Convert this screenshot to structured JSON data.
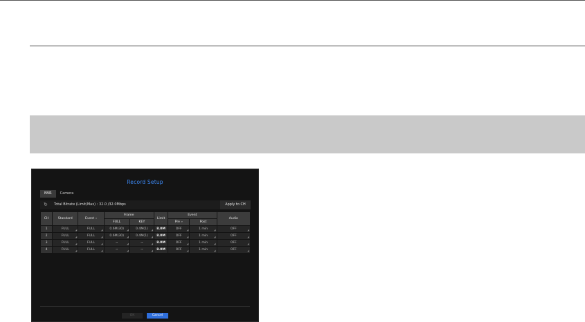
{
  "dialog": {
    "title": "Record Setup",
    "tabs": [
      "NVR",
      "Camera"
    ],
    "active_tab": "NVR",
    "bitrate_text": "Total Bitrate (Limit/Max) : 32.0 /32.0Mbps",
    "apply_button": "Apply to CH",
    "ok_button": "OK",
    "cancel_button": "Cancel"
  },
  "table": {
    "headers": {
      "ch": "CH",
      "standard": "Standard",
      "event": "Event",
      "frame": "Frame",
      "frame_full": "FULL",
      "frame_key": "KEY",
      "limit": "Limit",
      "event_group": "Event",
      "pre": "Pre",
      "post": "Post",
      "audio": "Audio"
    },
    "rows": [
      {
        "ch": "1",
        "standard": "FULL",
        "event": "FULL",
        "full": "0.6M(30)",
        "key": "0.4M(1)",
        "limit": "8.0M",
        "pre": "OFF",
        "post": "1 min",
        "audio": "OFF"
      },
      {
        "ch": "2",
        "standard": "FULL",
        "event": "FULL",
        "full": "0.6M(30)",
        "key": "0.4M(1)",
        "limit": "8.0M",
        "pre": "OFF",
        "post": "1 min",
        "audio": "OFF"
      },
      {
        "ch": "3",
        "standard": "FULL",
        "event": "FULL",
        "full": "~",
        "key": "~",
        "limit": "8.0M",
        "pre": "OFF",
        "post": "1 min",
        "audio": "OFF"
      },
      {
        "ch": "4",
        "standard": "FULL",
        "event": "FULL",
        "full": "~",
        "key": "~",
        "limit": "8.0M",
        "pre": "OFF",
        "post": "1 min",
        "audio": "OFF"
      }
    ]
  },
  "colors": {
    "title_blue": "#3d8af7",
    "cancel_blue": "#2f6fdc",
    "band_gray": "#c9c9c9"
  }
}
